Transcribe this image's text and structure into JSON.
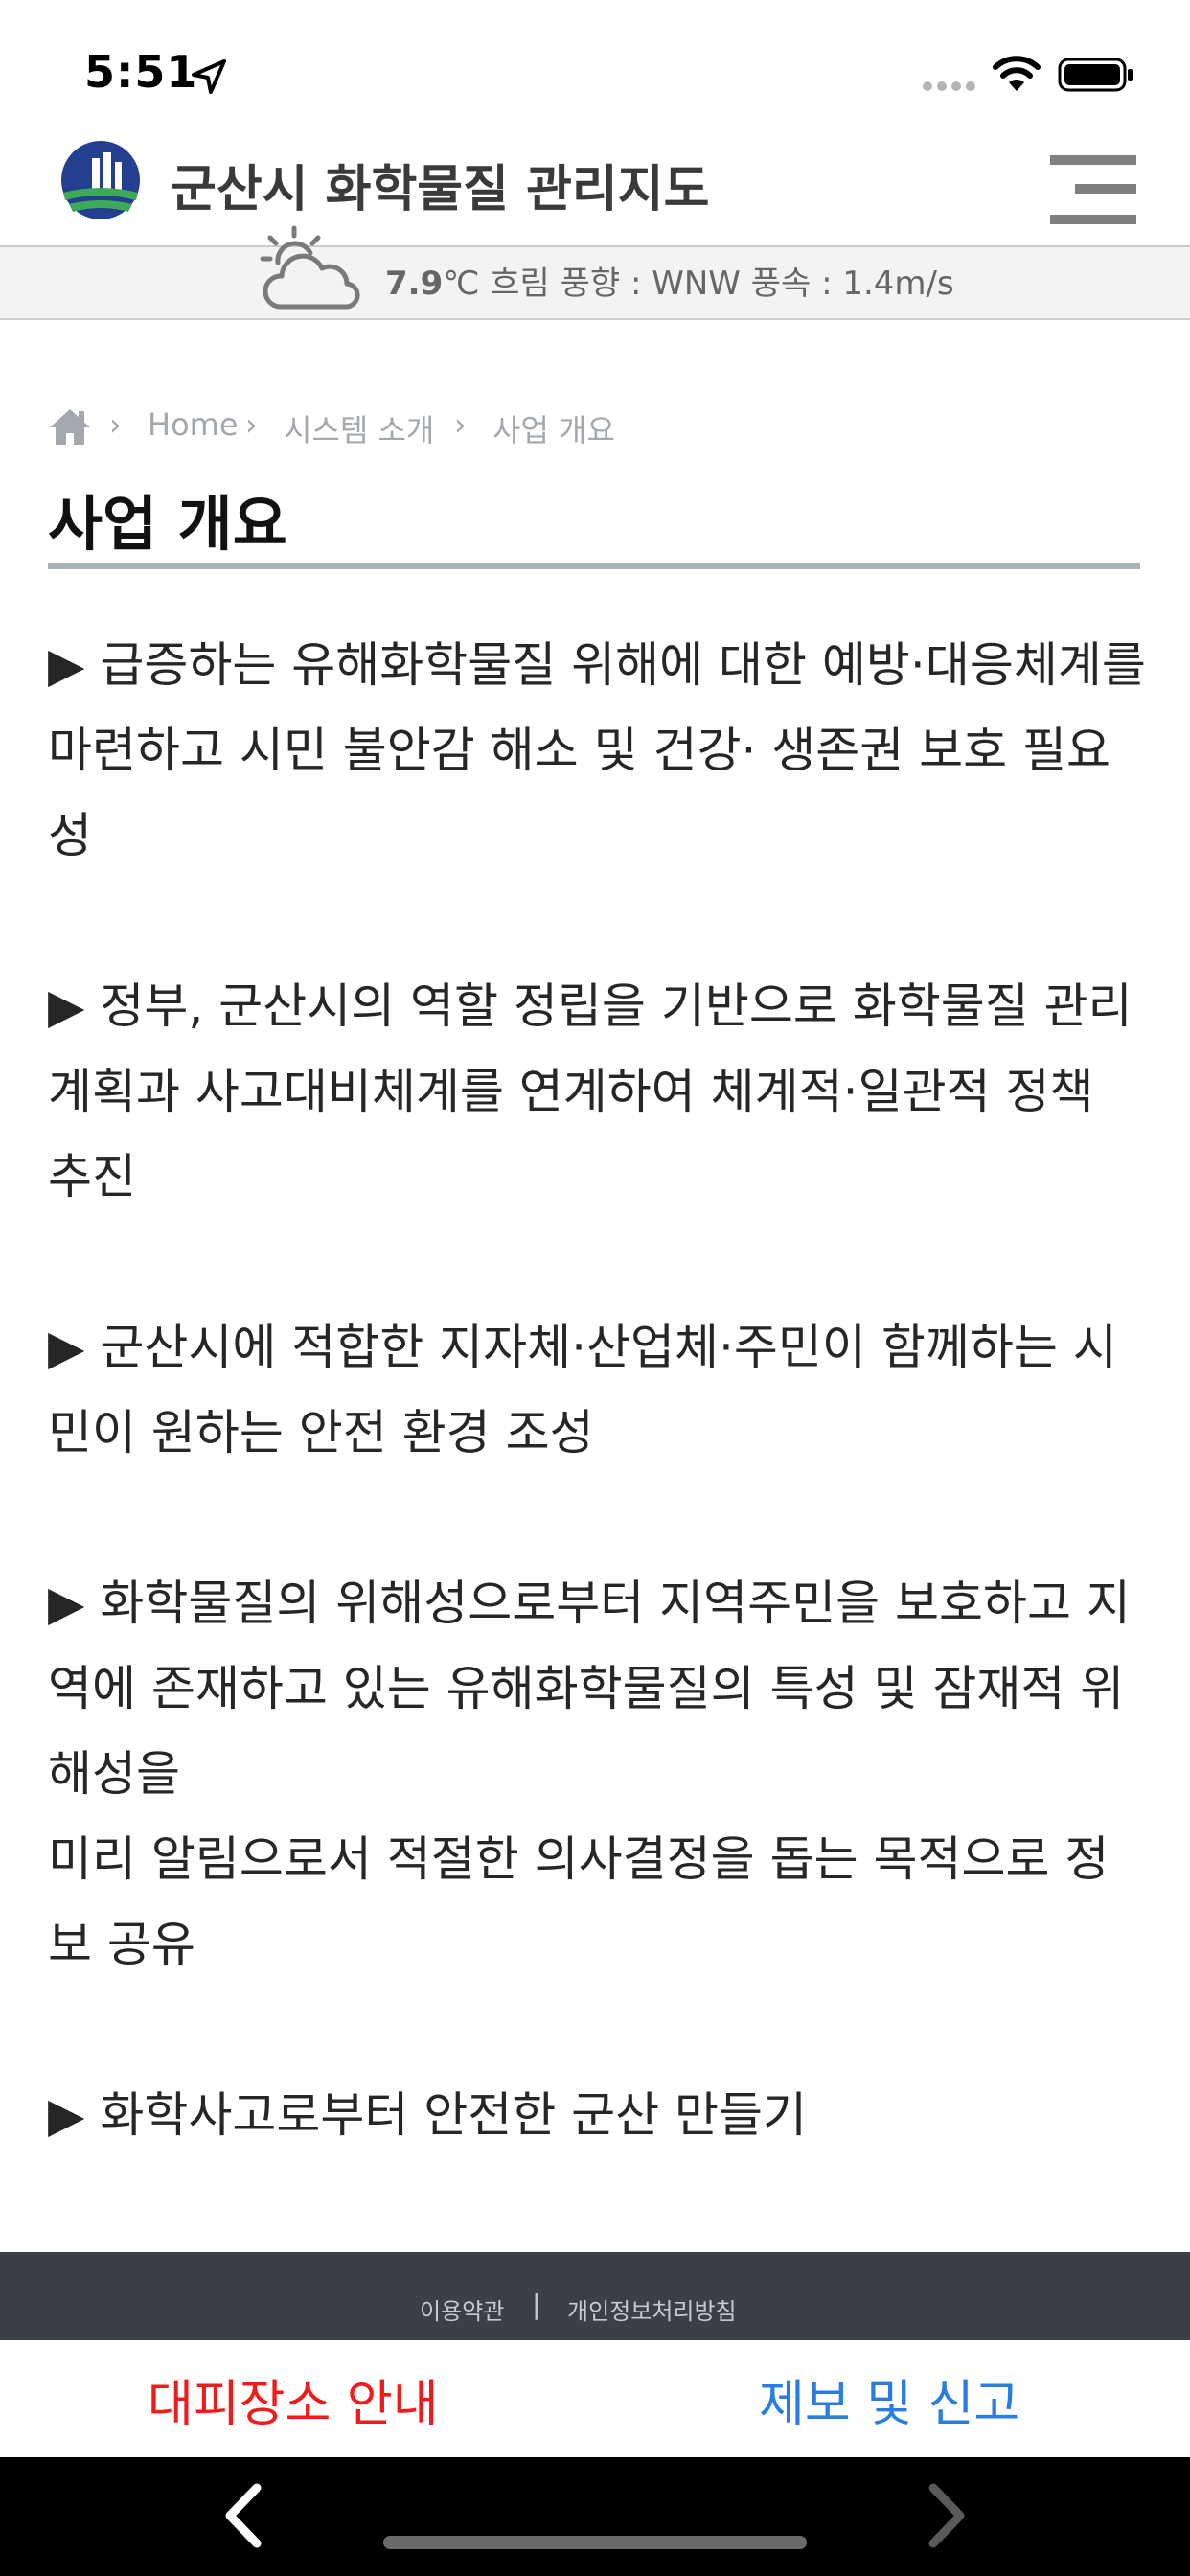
{
  "status_bar": {
    "time": "5:51",
    "icons": [
      "location-arrow-icon",
      "signal-dots-icon",
      "wifi-icon",
      "battery-icon"
    ]
  },
  "header": {
    "title": "군산시 화학물질 관리지도",
    "logo_icon": "gunsan-city-logo",
    "menu_icon": "hamburger-menu-icon"
  },
  "weather": {
    "icon": "cloudy-sun-icon",
    "temperature": "7.9",
    "unit": "℃",
    "description": " 흐림 풍향 : WNW 풍속 : 1.4m/s"
  },
  "breadcrumb": {
    "home_icon": "home-icon",
    "items": [
      "Home",
      "시스템 소개",
      "사업 개요"
    ]
  },
  "page": {
    "title": "사업 개요"
  },
  "content": {
    "paragraphs": [
      "▶ 급증하는 유해화학물질 위해에 대한 예방·대응체계를 마련하고 시민 불안감 해소 및  건강· 생존권 보호 필요성",
      "▶ 정부, 군산시의 역할 정립을 기반으로 화학물질 관리계획과 사고대비체계를 연계하여 체계적·일관적 정책 추진",
      "▶ 군산시에 적합한 지자체·산업체·주민이 함께하는 시민이 원하는 안전 환경 조성",
      "▶ 화학물질의 위해성으로부터 지역주민을 보호하고 지역에 존재하고 있는 유해화학물질의  특성 및 잠재적 위해성을\n    미리 알림으로서 적절한 의사결정을 돕는 목적으로 정보 공유",
      "▶ 화학사고로부터 안전한 군산 만들기"
    ]
  },
  "footer": {
    "terms": "이용약관",
    "separator": "|",
    "privacy": "개인정보처리방침"
  },
  "actions": {
    "evacuation": "대피장소 안내",
    "report": "제보 및 신고"
  },
  "colors": {
    "evacuation": "#ee1c1c",
    "report": "#2a7de0",
    "footer_bg": "#3b3f46",
    "title_rule": "#aab1b8"
  },
  "browser_nav": {
    "back_icon": "chevron-left-icon",
    "forward_icon": "chevron-right-icon"
  }
}
